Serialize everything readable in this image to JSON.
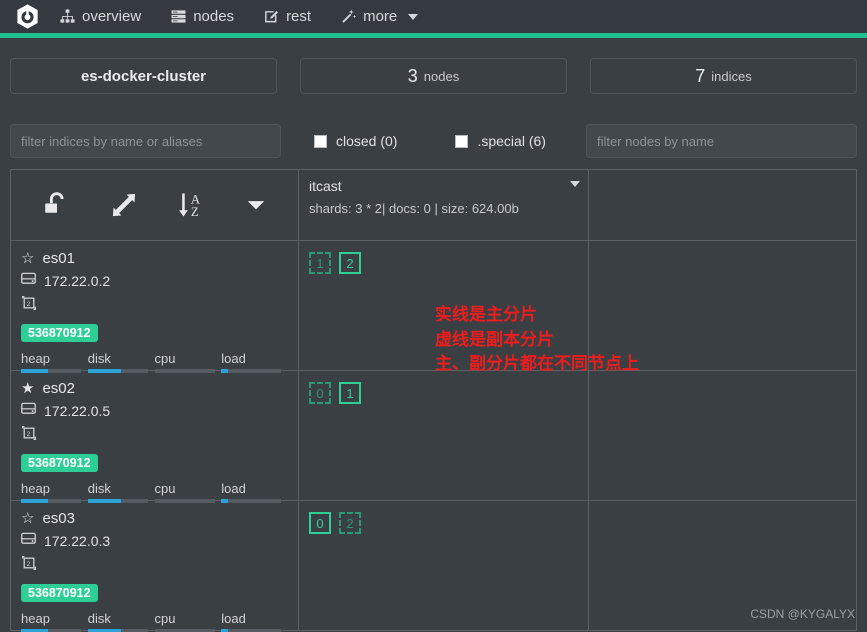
{
  "navbar": {
    "logo_icon": "cerebro-hexagon-logo",
    "items": [
      {
        "label": "overview",
        "icon": "sitemap-icon",
        "has_caret": false
      },
      {
        "label": "nodes",
        "icon": "server-icon",
        "has_caret": false
      },
      {
        "label": "rest",
        "icon": "edit-square-icon",
        "has_caret": false
      },
      {
        "label": "more",
        "icon": "magic-wand-icon",
        "has_caret": true
      }
    ],
    "accent_color": "#1fbf8f"
  },
  "cards": {
    "cluster_name": "es-docker-cluster",
    "nodes_count": "3",
    "nodes_label": "nodes",
    "indices_count": "7",
    "indices_label": "indices"
  },
  "filters": {
    "indices_placeholder": "filter indices by name or aliases",
    "nodes_placeholder": "filter nodes by name",
    "indices_value": "",
    "nodes_value": "",
    "checkboxes": [
      {
        "label": "closed (0)",
        "checked": false
      },
      {
        "label": ".special (6)",
        "checked": false
      }
    ]
  },
  "toolbar": {
    "buttons": [
      {
        "icon": "unlock-icon",
        "name": "lock-toggle"
      },
      {
        "icon": "expand-arrows-icon",
        "name": "expand-toggle"
      },
      {
        "icon": "sort-alpha-down-icon",
        "name": "sort-button"
      },
      {
        "icon": "chevron-down-icon",
        "name": "options-dropdown"
      }
    ]
  },
  "index_column": {
    "name": "itcast",
    "meta": "shards: 3 * 2| docs: 0 | size: 624.00b",
    "caret_icon": "chevron-down-icon"
  },
  "nodes": [
    {
      "name": "es01",
      "ip": "172.22.0.2",
      "is_master": false,
      "star_icon": "star-outline-icon",
      "disk_icon": "hdd-icon",
      "data_icon": "data-node-icon",
      "badge": "536870912",
      "badge_color": "#2ecf96",
      "metrics": [
        {
          "label": "heap",
          "percent": 45
        },
        {
          "label": "disk",
          "percent": 55
        },
        {
          "label": "cpu",
          "percent": 0
        },
        {
          "label": "load",
          "percent": 12
        }
      ],
      "shards": [
        {
          "id": "1",
          "type": "replica"
        },
        {
          "id": "2",
          "type": "primary"
        }
      ]
    },
    {
      "name": "es02",
      "ip": "172.22.0.5",
      "is_master": true,
      "star_icon": "star-filled-icon",
      "disk_icon": "hdd-icon",
      "data_icon": "data-node-icon",
      "badge": "536870912",
      "badge_color": "#2ecf96",
      "metrics": [
        {
          "label": "heap",
          "percent": 45
        },
        {
          "label": "disk",
          "percent": 55
        },
        {
          "label": "cpu",
          "percent": 0
        },
        {
          "label": "load",
          "percent": 12
        }
      ],
      "shards": [
        {
          "id": "0",
          "type": "replica"
        },
        {
          "id": "1",
          "type": "primary"
        }
      ]
    },
    {
      "name": "es03",
      "ip": "172.22.0.3",
      "is_master": false,
      "star_icon": "star-outline-icon",
      "disk_icon": "hdd-icon",
      "data_icon": "data-node-icon",
      "badge": "536870912",
      "badge_color": "#2ecf96",
      "metrics": [
        {
          "label": "heap",
          "percent": 45
        },
        {
          "label": "disk",
          "percent": 55
        },
        {
          "label": "cpu",
          "percent": 0
        },
        {
          "label": "load",
          "percent": 12
        }
      ],
      "shards": [
        {
          "id": "0",
          "type": "primary"
        },
        {
          "id": "2",
          "type": "replica"
        }
      ]
    }
  ],
  "annotation": {
    "line1": "实线是主分片",
    "line2": "虚线是副本分片",
    "line3": "主、副分片都在不同节点上",
    "color": "#ee1c1c"
  },
  "watermark": "CSDN @KYGALYX"
}
